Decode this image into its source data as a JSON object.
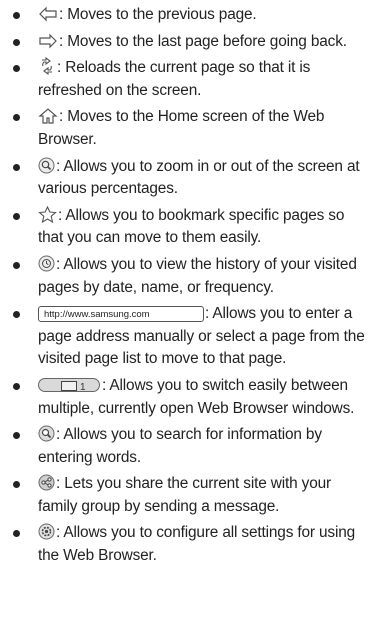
{
  "items": [
    {
      "icon": "back-arrow-icon",
      "text": ": Moves to the previous page."
    },
    {
      "icon": "forward-arrow-icon",
      "text": ": Moves to the last page before going back."
    },
    {
      "icon": "reload-icon",
      "text": ": Reloads the current page so that it is refreshed on the screen."
    },
    {
      "icon": "home-icon",
      "text": ": Moves to the Home screen of the Web Browser."
    },
    {
      "icon": "zoom-icon",
      "text": ": Allows you to zoom in or out of the screen at various percentages."
    },
    {
      "icon": "star-icon",
      "text": ": Allows you to bookmark specific pages so that you can move to them easily."
    },
    {
      "icon": "history-icon",
      "text": ": Allows you to view the history of your visited pages by date, name, or frequency."
    },
    {
      "icon": "address-bar-icon",
      "url": "http://www.samsung.com",
      "text": ": Allows you to enter a page address manually or select a page from the visited page list to move to that page."
    },
    {
      "icon": "windows-icon",
      "window_count": "1",
      "text": ": Allows you to switch easily between multiple, currently open Web Browser windows."
    },
    {
      "icon": "search-icon",
      "text": ": Allows you to search for information by entering words."
    },
    {
      "icon": "share-icon",
      "text": ": Lets you share the current site with your family group by sending a message."
    },
    {
      "icon": "settings-icon",
      "text": ": Allows you to configure all settings for using the Web Browser."
    }
  ]
}
